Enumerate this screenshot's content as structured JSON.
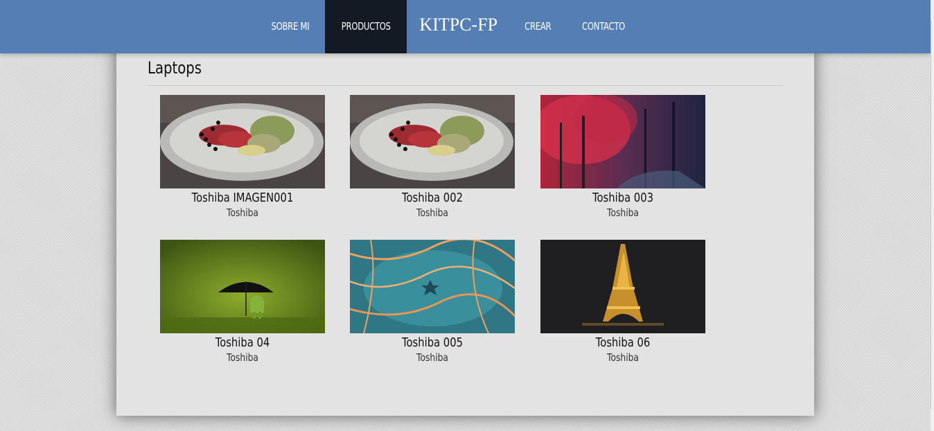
{
  "nav": {
    "items": [
      {
        "label": "SOBRE MI",
        "active": false
      },
      {
        "label": "PRODUCTOS",
        "active": true
      },
      {
        "label": "KITPC-FP",
        "brand": true
      },
      {
        "label": "CREAR",
        "active": false
      },
      {
        "label": "CONTACTO",
        "active": false
      }
    ]
  },
  "section": {
    "title": "Laptops"
  },
  "products": [
    {
      "title": "Toshiba IMAGEN001",
      "brand": "Toshiba",
      "image": "plated-food-photo"
    },
    {
      "title": "Toshiba 002",
      "brand": "Toshiba",
      "image": "plated-food-photo"
    },
    {
      "title": "Toshiba 003",
      "brand": "Toshiba",
      "image": "red-forest-photo"
    },
    {
      "title": "Toshiba 04",
      "brand": "Toshiba",
      "image": "android-umbrella-photo"
    },
    {
      "title": "Toshiba 005",
      "brand": "Toshiba",
      "image": "starfish-water-photo"
    },
    {
      "title": "Toshiba 06",
      "brand": "Toshiba",
      "image": "eiffel-tower-night-photo"
    }
  ],
  "colors": {
    "header": "#557fb4",
    "active_nav": "#131a23",
    "panel": "#e3e3e3"
  }
}
